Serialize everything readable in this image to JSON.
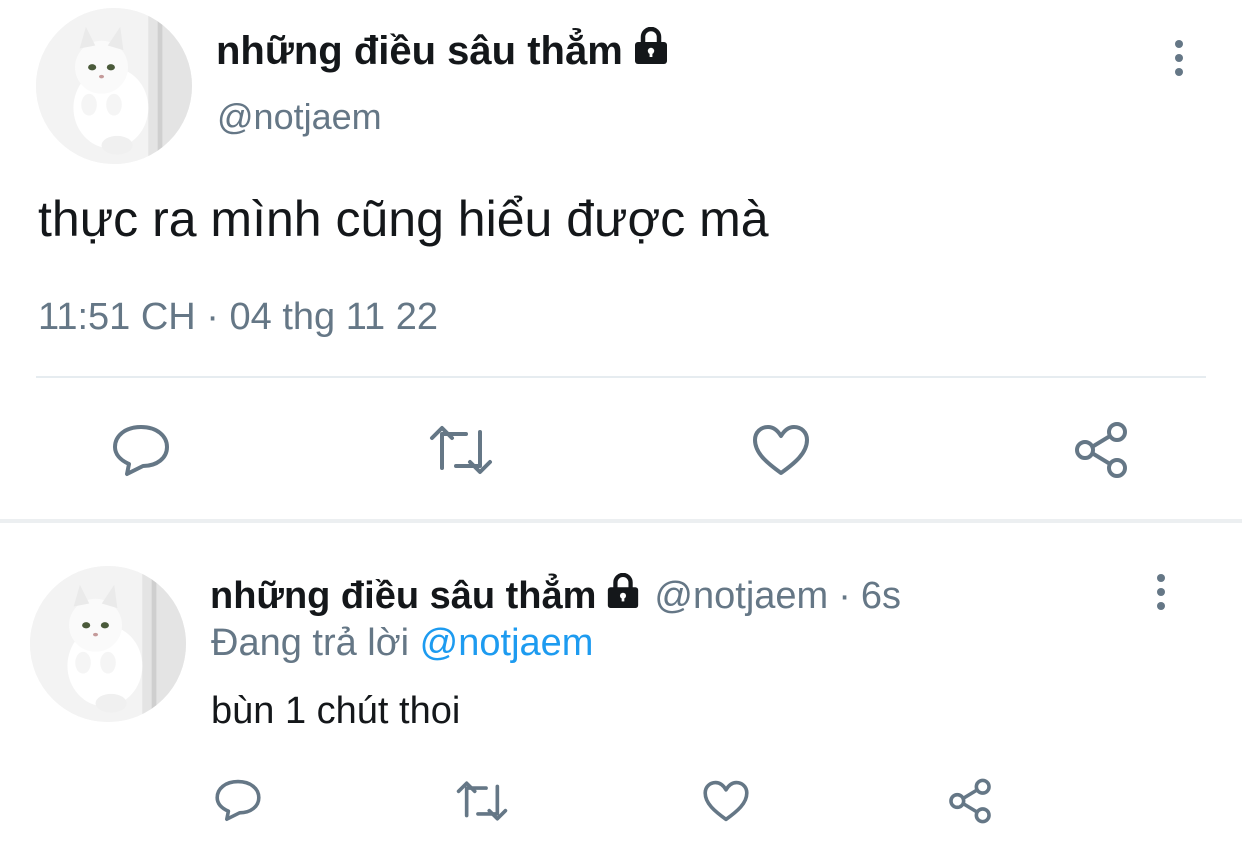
{
  "main_tweet": {
    "display_name": "những điều sâu thẳm",
    "handle": "@notjaem",
    "text": "thực ra mình cũng hiểu được mà",
    "time": "11:51 CH",
    "separator": "·",
    "date": "04 thg 11 22",
    "protected_icon": "lock-icon",
    "more_icon": "more-vertical-icon",
    "actions": [
      "reply-icon",
      "retweet-icon",
      "like-icon",
      "share-icon"
    ]
  },
  "reply_tweet": {
    "display_name": "những điều sâu thẳm",
    "handle": "@notjaem",
    "separator": "·",
    "age": "6s",
    "replying_prefix": "Đang trả lời",
    "replying_to": "@notjaem",
    "text": "bùn 1 chút thoi",
    "protected_icon": "lock-icon",
    "more_icon": "more-vertical-icon",
    "actions": [
      "reply-icon",
      "retweet-icon",
      "like-icon",
      "share-icon"
    ]
  },
  "colors": {
    "text": "#14171a",
    "muted": "#657786",
    "link": "#1d9bf0",
    "divider": "#e6ecf0"
  }
}
